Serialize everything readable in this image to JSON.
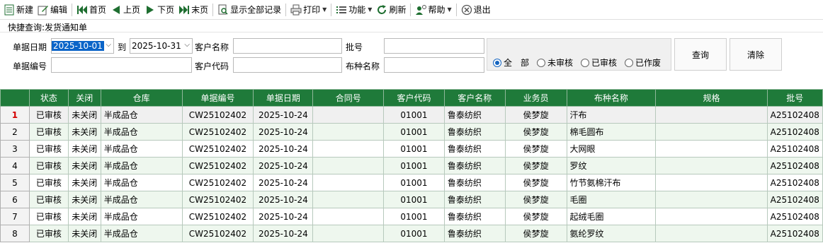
{
  "toolbar": {
    "new": "新建",
    "edit": "编辑",
    "first": "首页",
    "prev": "上页",
    "next": "下页",
    "last": "末页",
    "show_all": "显示全部记录",
    "print": "打印",
    "function": "功能",
    "refresh": "刷新",
    "help": "帮助",
    "exit": "退出"
  },
  "query": {
    "title": "快捷查询:发货通知单",
    "date_label": "单据日期",
    "date_from": "2025-10-01",
    "to_label": "到",
    "date_to": "2025-10-31",
    "customer_name_label": "客户名称",
    "customer_name_value": "",
    "batch_label": "批号",
    "batch_value": "",
    "doc_no_label": "单据编号",
    "doc_no_value": "",
    "customer_code_label": "客户代码",
    "customer_code_value": "",
    "fabric_name_label": "布种名称",
    "fabric_name_value": "",
    "radios": [
      "全　部",
      "未审核",
      "已审核",
      "已作废"
    ],
    "radio_selected": "全　部",
    "search_btn": "查询",
    "clear_btn": "清除"
  },
  "grid": {
    "columns": [
      "",
      "状态",
      "关闭",
      "仓库",
      "单据编号",
      "单据日期",
      "合同号",
      "客户代码",
      "客户名称",
      "业务员",
      "布种名称",
      "规格",
      "批号"
    ],
    "rows": [
      [
        "1",
        "已审核",
        "未关闭",
        "半成品仓",
        "CW25102402",
        "2025-10-24",
        "",
        "01001",
        "鲁泰纺织",
        "侯梦旋",
        "汗布",
        "",
        "A25102408"
      ],
      [
        "2",
        "已审核",
        "未关闭",
        "半成品仓",
        "CW25102402",
        "2025-10-24",
        "",
        "01001",
        "鲁泰纺织",
        "侯梦旋",
        "棉毛圆布",
        "",
        "A25102408"
      ],
      [
        "3",
        "已审核",
        "未关闭",
        "半成品仓",
        "CW25102402",
        "2025-10-24",
        "",
        "01001",
        "鲁泰纺织",
        "侯梦旋",
        "大网眼",
        "",
        "A25102408"
      ],
      [
        "4",
        "已审核",
        "未关闭",
        "半成品仓",
        "CW25102402",
        "2025-10-24",
        "",
        "01001",
        "鲁泰纺织",
        "侯梦旋",
        "罗纹",
        "",
        "A25102408"
      ],
      [
        "5",
        "已审核",
        "未关闭",
        "半成品仓",
        "CW25102402",
        "2025-10-24",
        "",
        "01001",
        "鲁泰纺织",
        "侯梦旋",
        "竹节氨棉汗布",
        "",
        "A25102408"
      ],
      [
        "6",
        "已审核",
        "未关闭",
        "半成品仓",
        "CW25102402",
        "2025-10-24",
        "",
        "01001",
        "鲁泰纺织",
        "侯梦旋",
        "毛圈",
        "",
        "A25102408"
      ],
      [
        "7",
        "已审核",
        "未关闭",
        "半成品仓",
        "CW25102402",
        "2025-10-24",
        "",
        "01001",
        "鲁泰纺织",
        "侯梦旋",
        "起绒毛圈",
        "",
        "A25102408"
      ],
      [
        "8",
        "已审核",
        "未关闭",
        "半成品仓",
        "CW25102402",
        "2025-10-24",
        "",
        "01001",
        "鲁泰纺织",
        "侯梦旋",
        "氨纶罗纹",
        "",
        "A25102408"
      ]
    ]
  },
  "colors": {
    "header_green": "#1f7a3a",
    "row_alt": "#eef7ee",
    "selection_blue": "#0a64c8",
    "current_row_red": "#d40000"
  }
}
